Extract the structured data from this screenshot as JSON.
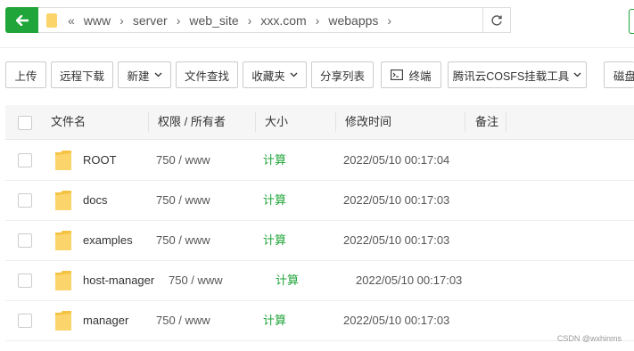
{
  "nav": {
    "breadcrumb": [
      "www",
      "server",
      "web_site",
      "xxx.com",
      "webapps"
    ],
    "crumb_sep": "«",
    "arrow": "›"
  },
  "toolbar": [
    {
      "id": "upload",
      "label": "上传",
      "caret": false
    },
    {
      "id": "remote-download",
      "label": "远程下载",
      "caret": false
    },
    {
      "id": "new",
      "label": "新建",
      "caret": true
    },
    {
      "id": "file-search",
      "label": "文件查找",
      "caret": false
    },
    {
      "id": "favorites",
      "label": "收藏夹",
      "caret": true
    },
    {
      "id": "share-list",
      "label": "分享列表",
      "caret": false
    },
    {
      "id": "terminal",
      "label": "终端",
      "caret": false,
      "icon": "terminal-icon"
    },
    {
      "id": "cosfs",
      "label": "腾讯云COSFS挂载工具",
      "caret": true
    },
    {
      "id": "disk",
      "label": "磁盘",
      "caret": false
    }
  ],
  "table": {
    "headers": {
      "name": "文件名",
      "perm": "权限 / 所有者",
      "size": "大小",
      "mtime": "修改时间",
      "remark": "备注"
    },
    "rows": [
      {
        "name": "ROOT",
        "perm": "750 / www",
        "size": "计算",
        "mtime": "2022/05/10 00:17:04"
      },
      {
        "name": "docs",
        "perm": "750 / www",
        "size": "计算",
        "mtime": "2022/05/10 00:17:03"
      },
      {
        "name": "examples",
        "perm": "750 / www",
        "size": "计算",
        "mtime": "2022/05/10 00:17:03"
      },
      {
        "name": "host-manager",
        "perm": "750 / www",
        "size": "计算",
        "mtime": "2022/05/10 00:17:03"
      },
      {
        "name": "manager",
        "perm": "750 / www",
        "size": "计算",
        "mtime": "2022/05/10 00:17:03"
      }
    ]
  },
  "watermark": "CSDN @wxhinms",
  "colors": {
    "accent": "#20a53a",
    "folder": "#fbd46b"
  }
}
